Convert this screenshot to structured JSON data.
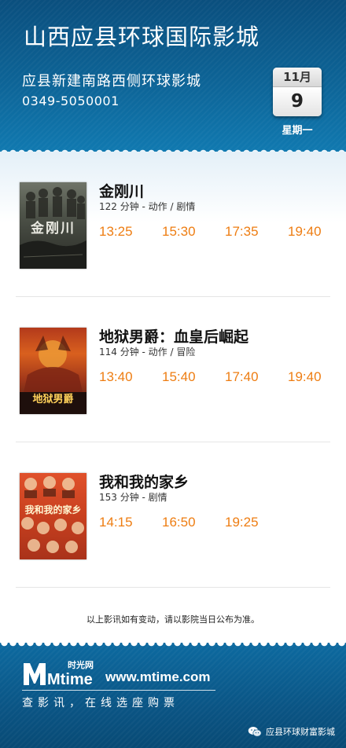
{
  "cinema": {
    "name": "山西应县环球国际影城",
    "address": "应县新建南路西侧环球影城",
    "phone": "0349-5050001"
  },
  "date": {
    "month": "11月",
    "day": "9",
    "weekday": "星期一"
  },
  "movies": [
    {
      "title": "金刚川",
      "meta": "122 分钟 - 动作 / 剧情",
      "poster_text": "金刚川",
      "showtimes": [
        "13:25",
        "15:30",
        "17:35",
        "19:40"
      ]
    },
    {
      "title": "地狱男爵：血皇后崛起",
      "meta": "114 分钟 - 动作 / 冒险",
      "poster_text": "地狱男爵",
      "showtimes": [
        "13:40",
        "15:40",
        "17:40",
        "19:40"
      ]
    },
    {
      "title": "我和我的家乡",
      "meta": "153 分钟 - 剧情",
      "poster_text": "我和我的家乡",
      "showtimes": [
        "14:15",
        "16:50",
        "19:25"
      ]
    }
  ],
  "notice": "以上影讯如有变动，请以影院当日公布为准。",
  "footer": {
    "logo_text": "Mtime",
    "logo_sub": "时光网",
    "url": "www.mtime.com",
    "slogan": "查影讯，在线选座购票",
    "wechat_account": "应县环球财富影城"
  },
  "colors": {
    "header_bg": "#0d6497",
    "showtime": "#ee7d12",
    "footer_bg": "#0a5585"
  }
}
